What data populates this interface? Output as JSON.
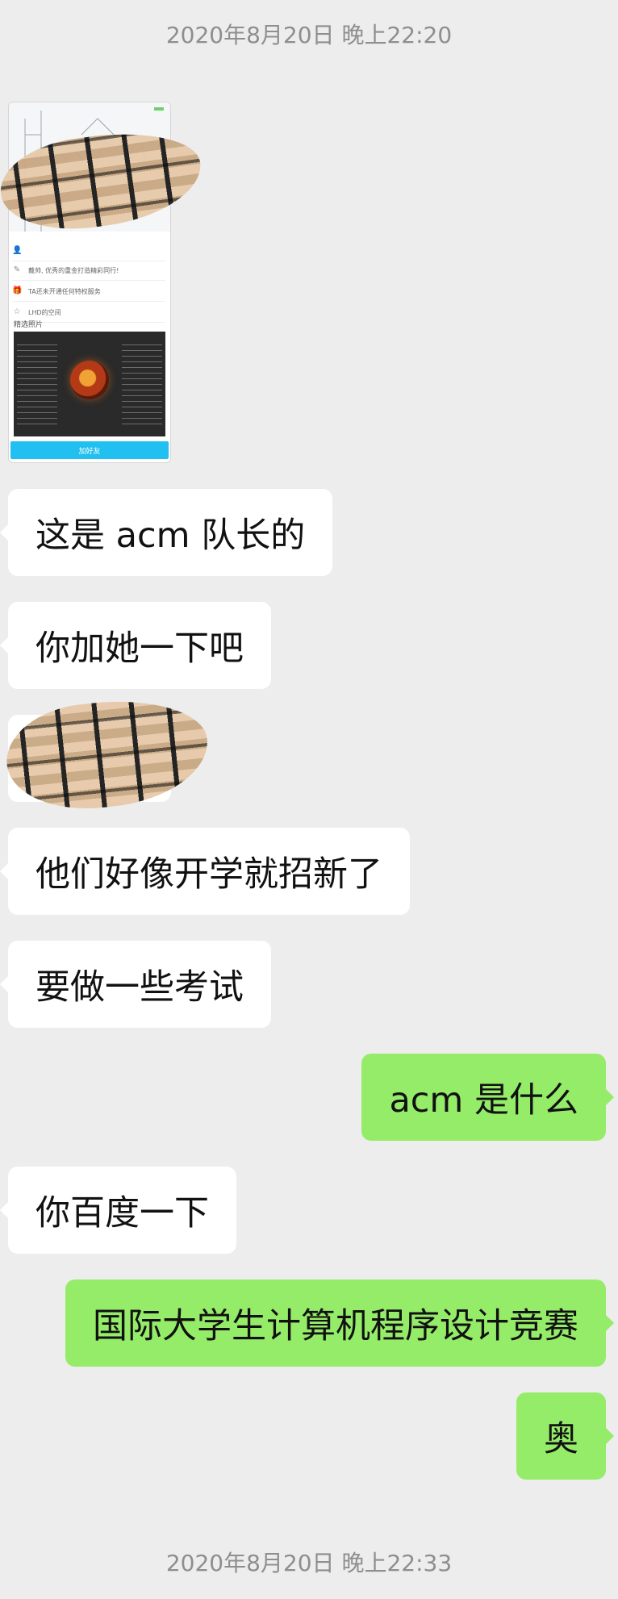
{
  "timestamps": {
    "top": "2020年8月20日 晚上22:20",
    "bottom": "2020年8月20日 晚上22:33"
  },
  "shared_card": {
    "rows": [
      "戴帅, 优秀的重金打造精彩同行!",
      "TA还未开通任何特权服务",
      "LHD的空间"
    ],
    "section_title": "精选照片",
    "button_label": "加好友"
  },
  "messages": [
    {
      "side": "left",
      "text": "这是 acm 队长的"
    },
    {
      "side": "left",
      "text": "你加她一下吧"
    },
    {
      "side": "left",
      "text": "他们好像开学就招新了"
    },
    {
      "side": "left",
      "text": "要做一些考试"
    },
    {
      "side": "right",
      "text": "acm 是什么"
    },
    {
      "side": "left",
      "text": "你百度一下"
    },
    {
      "side": "right",
      "text": "国际大学生计算机程序设计竞赛"
    },
    {
      "side": "right",
      "text": "奥"
    }
  ],
  "colors": {
    "background": "#ededed",
    "bubble_left": "#ffffff",
    "bubble_right": "#95ec69",
    "timestamp": "#8e8e8e",
    "card_button": "#22c0f0"
  }
}
